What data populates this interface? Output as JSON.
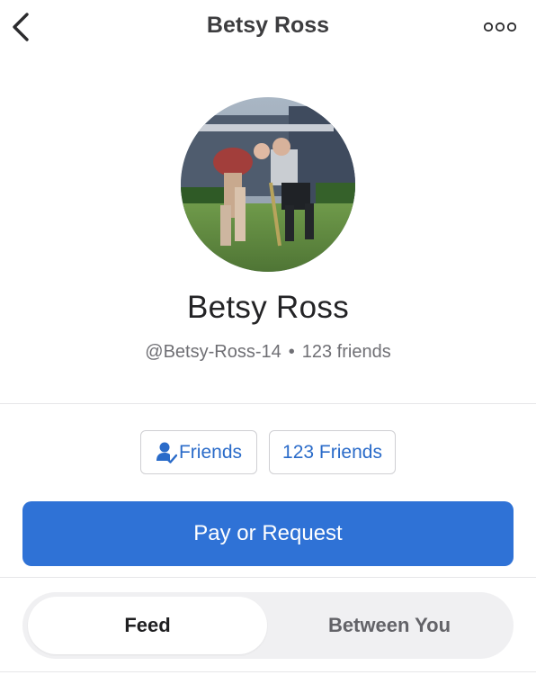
{
  "header": {
    "title": "Betsy Ross",
    "back_icon": "chevron-left-icon",
    "more_icon": "more-horizontal-icon"
  },
  "profile": {
    "display_name": "Betsy Ross",
    "username": "@Betsy-Ross-14",
    "separator": "•",
    "friends_count_text": "123 friends"
  },
  "actions": {
    "friend_status_label": "Friends",
    "friend_status_icon": "person-check-icon",
    "friends_count_button_label": "123 Friends",
    "pay_label": "Pay or Request"
  },
  "tabs": [
    {
      "label": "Feed",
      "selected": true
    },
    {
      "label": "Between You",
      "selected": false
    }
  ],
  "colors": {
    "accent": "#2f72d6",
    "link": "#2a6bc9"
  }
}
